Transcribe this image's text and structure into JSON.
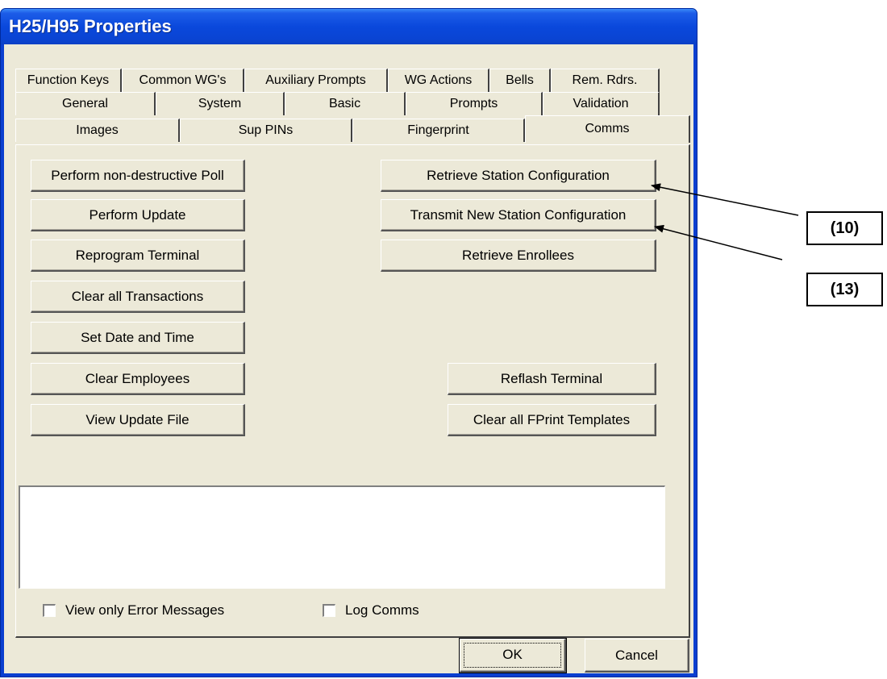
{
  "window": {
    "title": "H25/H95 Properties"
  },
  "tabs": {
    "row1": [
      "Function Keys",
      "Common WG's",
      "Auxiliary Prompts",
      "WG Actions",
      "Bells",
      "Rem. Rdrs."
    ],
    "row2": [
      "General",
      "System",
      "Basic",
      "Prompts",
      "Validation"
    ],
    "row3": [
      "Images",
      "Sup PINs",
      "Fingerprint",
      "Comms"
    ],
    "active": "Comms"
  },
  "buttons": {
    "poll": "Perform non-destructive Poll",
    "update": "Perform Update",
    "reprogram": "Reprogram Terminal",
    "clear_transactions": "Clear all Transactions",
    "set_date_time": "Set Date and Time",
    "clear_employees": "Clear Employees",
    "view_update_file": "View Update File",
    "retrieve_config": "Retrieve Station Configuration",
    "transmit_config": "Transmit New Station Configuration",
    "retrieve_enrollees": "Retrieve Enrollees",
    "reflash": "Reflash Terminal",
    "clear_fprint": "Clear all FPrint Templates",
    "ok": "OK",
    "cancel": "Cancel"
  },
  "checkboxes": {
    "error_only": "View only Error Messages",
    "log_comms": "Log Comms"
  },
  "annotations": {
    "callout_10": "(10)",
    "callout_13": "(13)"
  }
}
